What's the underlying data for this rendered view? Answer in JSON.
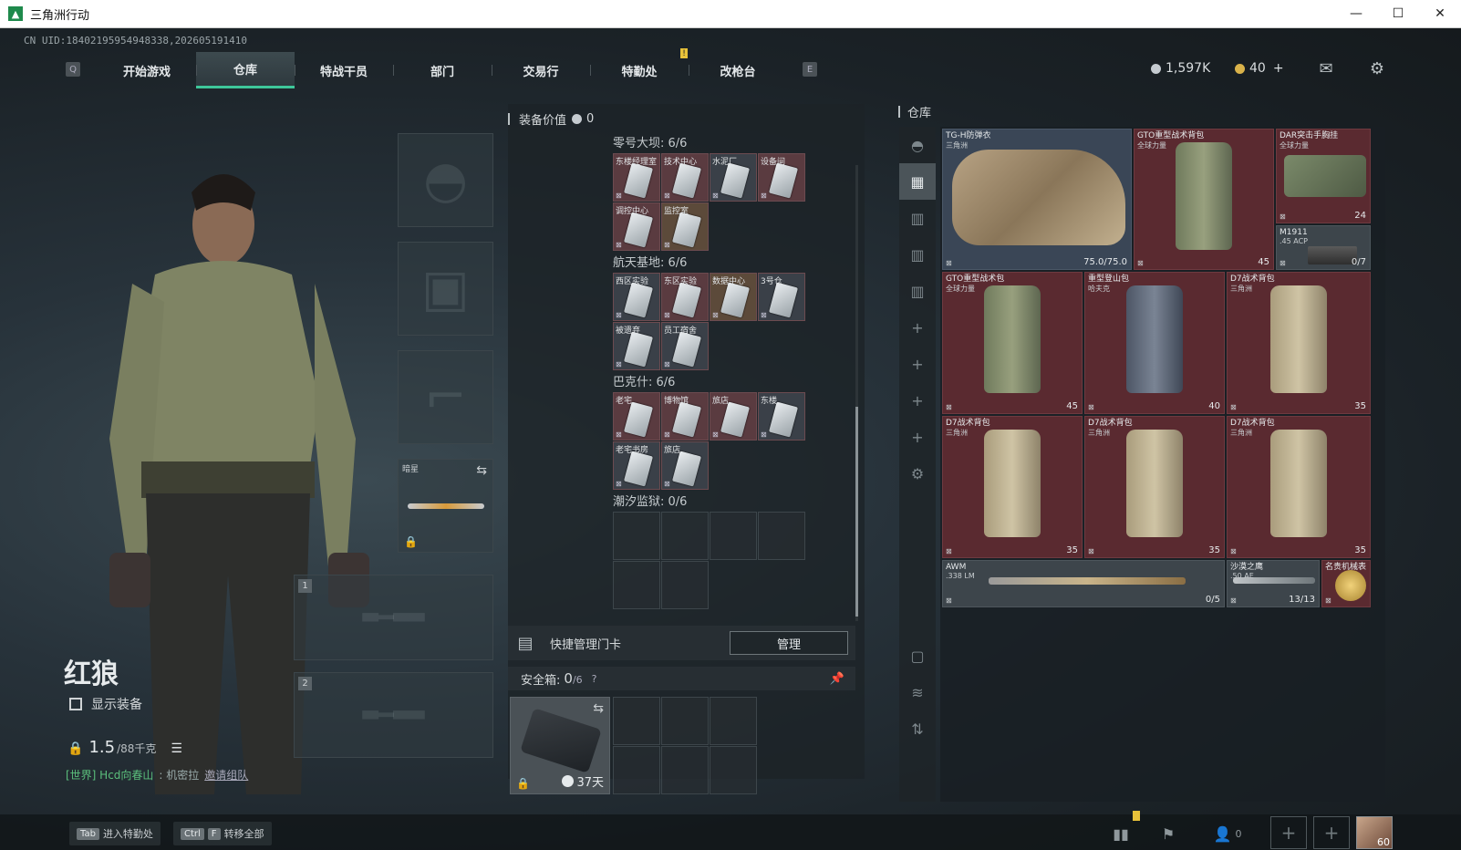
{
  "window": {
    "title": "三角洲行动",
    "controls": [
      "—",
      "☐",
      "✕"
    ]
  },
  "uid": "CN UID:18402195954948338,202605191410",
  "nav": {
    "left_key": "Q",
    "right_key": "E",
    "tabs": [
      "开始游戏",
      "仓库",
      "特战干员",
      "部门",
      "交易行",
      "特勤处",
      "改枪台"
    ],
    "active": "仓库"
  },
  "currency": {
    "silver": "1,597K",
    "gold": "40",
    "gold_add": "+"
  },
  "operator": {
    "name": "红狼",
    "show_equipment_label": "显示装备",
    "weight_current": "1.5",
    "weight_max": "/88千克",
    "chat_channel": "[世界] Hcd向春山",
    "chat_user": ": 机密拉",
    "chat_link": "邀请组队"
  },
  "equip_slots": {
    "melee_label": "暗星",
    "primary_num": "1",
    "secondary_num": "2"
  },
  "equipment_value": {
    "label": "装备价值",
    "value": "0"
  },
  "keyring": {
    "sections": [
      {
        "title": "零号大坝: 6/6",
        "keys": [
          {
            "name": "东楼经理室",
            "tone": "red"
          },
          {
            "name": "技术中心",
            "tone": "red"
          },
          {
            "name": "水泥厂",
            "tone": "dark"
          },
          {
            "name": "设备间",
            "tone": "red"
          },
          {
            "name": "调控中心",
            "tone": "red"
          },
          {
            "name": "监控室",
            "tone": "brown"
          }
        ],
        "empty": 0
      },
      {
        "title": "航天基地: 6/6",
        "keys": [
          {
            "name": "西区实验",
            "tone": "dark"
          },
          {
            "name": "东区实验",
            "tone": "red"
          },
          {
            "name": "数据中心",
            "tone": "brown"
          },
          {
            "name": "3号仓",
            "tone": "dark"
          },
          {
            "name": "被遗弃",
            "tone": "dark"
          },
          {
            "name": "员工宿舍",
            "tone": "dark"
          }
        ],
        "empty": 0
      },
      {
        "title": "巴克什: 6/6",
        "keys": [
          {
            "name": "老宅",
            "tone": "red"
          },
          {
            "name": "博物馆",
            "tone": "red"
          },
          {
            "name": "旅店",
            "tone": "red"
          },
          {
            "name": "东楼",
            "tone": "dark"
          },
          {
            "name": "老宅书房",
            "tone": "dark"
          },
          {
            "name": "旅店",
            "tone": "dark"
          }
        ],
        "empty": 0
      },
      {
        "title": "潮汐监狱: 0/6",
        "keys": [],
        "empty": 6
      }
    ]
  },
  "quick_manage": {
    "label": "快捷管理门卡",
    "button": "管理"
  },
  "safe": {
    "label": "安全箱:",
    "count": "0",
    "capacity": "/6",
    "help": "?",
    "days": "37天"
  },
  "warehouse": {
    "title": "仓库",
    "items": [
      {
        "name": "TG-H防弹衣",
        "sub": "三角洲",
        "count": "75.0/75.0",
        "tone": "blue",
        "art": "vest"
      },
      {
        "name": "GTO重型战术背包",
        "sub": "全球力量",
        "count": "45",
        "tone": "red",
        "art": "bp-olive"
      },
      {
        "name": "DAR突击手胸挂",
        "sub": "全球力量",
        "count": "24",
        "tone": "red",
        "art": "rig"
      },
      {
        "name": "M1911",
        "sub": ".45 ACP",
        "count": "0/7",
        "tone": "gray",
        "art": "pistol"
      },
      {
        "name": "GTO重型战术包",
        "sub": "全球力量",
        "count": "45",
        "tone": "red",
        "art": "bp-olive"
      },
      {
        "name": "重型登山包",
        "sub": "哈夫克",
        "count": "40",
        "tone": "red",
        "art": "bp-navy"
      },
      {
        "name": "D7战术背包",
        "sub": "三角洲",
        "count": "35",
        "tone": "red",
        "art": "bp-tan"
      },
      {
        "name": "D7战术背包",
        "sub": "三角洲",
        "count": "35",
        "tone": "red",
        "art": "bp-tan"
      },
      {
        "name": "D7战术背包",
        "sub": "三角洲",
        "count": "35",
        "tone": "red",
        "art": "bp-tan"
      },
      {
        "name": "D7战术背包",
        "sub": "三角洲",
        "count": "35",
        "tone": "red",
        "art": "bp-tan"
      },
      {
        "name": "AWM",
        "sub": ".338 LM",
        "count": "0/5",
        "tone": "gray",
        "art": "rifle"
      },
      {
        "name": "沙漠之鹰",
        "sub": ".50 AE",
        "count": "13/13",
        "tone": "gray",
        "art": "rifle2"
      },
      {
        "name": "名贵机械表",
        "sub": "",
        "count": "",
        "tone": "red",
        "art": "watch"
      }
    ]
  },
  "bottom": {
    "enter_label": "进入特勤处",
    "enter_key": "Tab",
    "transfer_label": "转移全部",
    "transfer_keys": [
      "Ctrl",
      "F"
    ],
    "friends_count": "0",
    "level": "60"
  }
}
